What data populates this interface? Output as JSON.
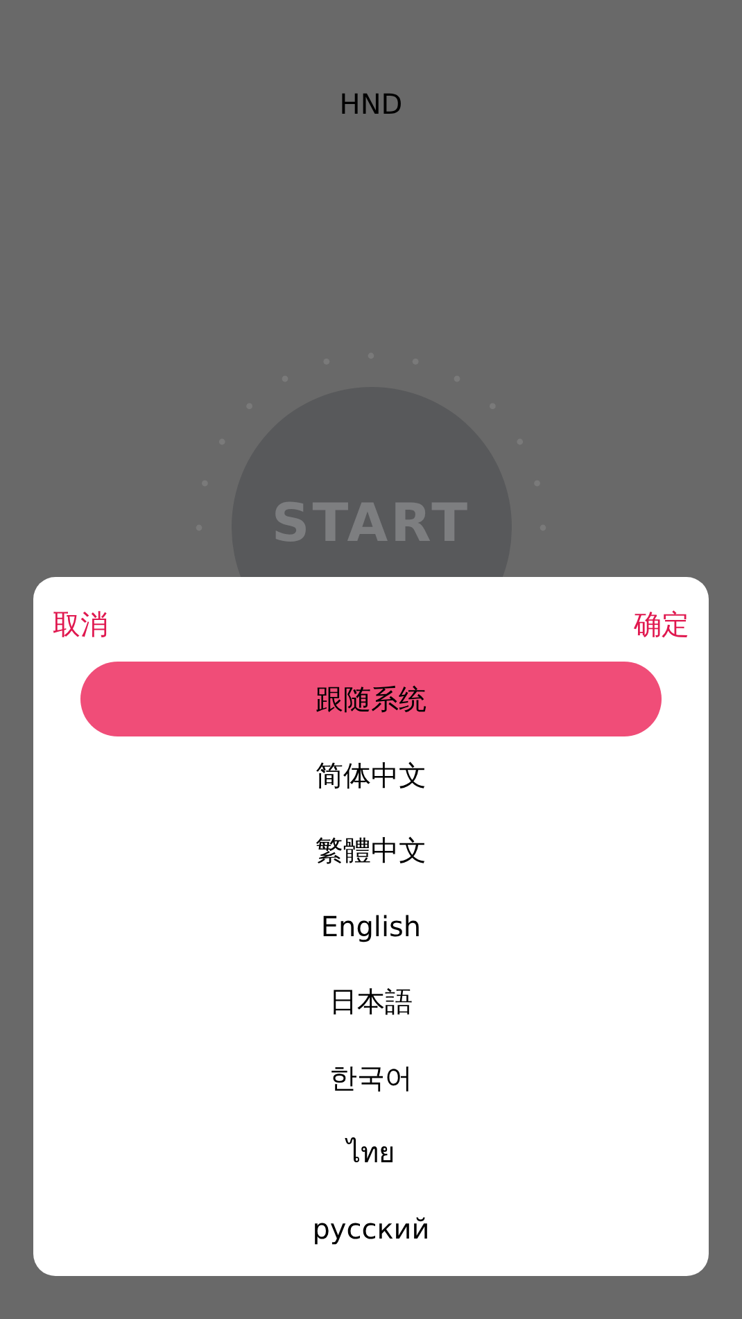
{
  "title": "HND",
  "start_logo": "START",
  "sheet": {
    "cancel": "取消",
    "confirm": "确定",
    "options": [
      {
        "label": "跟随系统",
        "selected": true
      },
      {
        "label": "简体中文",
        "selected": false
      },
      {
        "label": "繁體中文",
        "selected": false
      },
      {
        "label": "English",
        "selected": false
      },
      {
        "label": "日本語",
        "selected": false
      },
      {
        "label": "한국어",
        "selected": false
      },
      {
        "label": "ไทย",
        "selected": false
      },
      {
        "label": "русский",
        "selected": false
      }
    ]
  }
}
